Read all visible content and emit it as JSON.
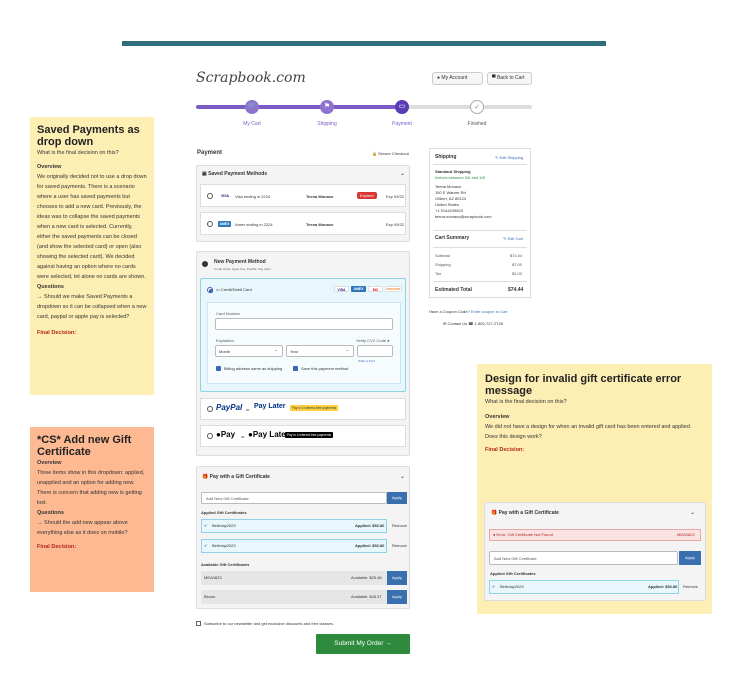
{
  "header": {
    "logo": "Scrapbook.com",
    "my_account": "My Account",
    "back_to_cart": "Back to Cart"
  },
  "steps": [
    {
      "label": "My Cart"
    },
    {
      "label": "Shipping"
    },
    {
      "label": "Payment"
    },
    {
      "label": "Finished"
    }
  ],
  "payment": {
    "title": "Payment",
    "secure": "Secure Checkout",
    "saved_title": "Saved Payment Methods",
    "saved": [
      {
        "brand": "VISA",
        "ending": "Visa ending in 2224",
        "name": "Teena Monaco",
        "badge": "Expired",
        "exp": "Exp 09/22"
      },
      {
        "brand": "AMEX",
        "ending": "Amex ending in 2224",
        "name": "Teena Monaco",
        "badge": "",
        "exp": "Exp 09/22"
      }
    ],
    "new_title": "New Payment Method",
    "new_sub": "Credit cards, Apple Pay, PayPal, Pay Later",
    "card_label": "Credit/Debit Card",
    "card_brands": [
      "VISA",
      "AMEX",
      "MC",
      "DISCOVER"
    ],
    "card_number_label": "Card Number",
    "expiration_label": "Expiration",
    "month_placeholder": "Month",
    "year_placeholder": "Year",
    "cvv_label": "Verify CVV Code",
    "whats_this": "What is this?",
    "billing_same": "Billing address same as shipping",
    "save_method": "Save this payment method",
    "paypal_text": "PayPal",
    "or1": "or",
    "paylater": "Pay Later",
    "paypal_badge": "Pay in 4 interest-free payments",
    "applepay": "Pay",
    "or2": "or",
    "apple_paylater": "Pay Later",
    "apple_badge": "Pay in 4 interest-free payments"
  },
  "gift": {
    "title": "Pay with a Gift Certificate",
    "placeholder": "Add New Gift Certificate",
    "apply": "Apply",
    "applied_title": "Applied Gift Certificates",
    "applied": [
      {
        "code": "Birthday2023",
        "amount": "Applied: $53.80",
        "remove": "Remove"
      },
      {
        "code": "Birthday2023",
        "amount": "Applied: $53.80",
        "remove": "Remove"
      }
    ],
    "available_title": "Available Gift Certificates",
    "available": [
      {
        "code": "MEA0823",
        "amount": "Available: $25.48",
        "apply": "Apply"
      },
      {
        "code": "Bloom",
        "amount": "Available: $45.37",
        "apply": "Apply"
      }
    ]
  },
  "newsletter": "Subscribe to our newsletter and get exclusive discounts and free classes.",
  "submit": "Submit My Order",
  "shipping_box": {
    "title": "Shipping",
    "edit": "Edit Shipping",
    "method": "Standard Shipping",
    "arrives": "Arrives between 3/6 and 3/8",
    "address": [
      "Teena Monaco",
      "150 E Warner Rd",
      "Gilbert, AZ 85123",
      "United States",
      "+1 9144249823",
      "teena.monaco@scrapbook.com"
    ]
  },
  "cart_summary": {
    "title": "Cart Summary",
    "edit": "Edit Cart",
    "rows": [
      {
        "label": "Subtotal",
        "value": "$74.44"
      },
      {
        "label": "Shipping",
        "value": "$7.00"
      },
      {
        "label": "Tax",
        "value": "$2.00"
      }
    ],
    "total_label": "Estimated Total",
    "total_value": "$74.44",
    "coupon_q": "Have a Coupon Code?",
    "coupon_link": "Enter coupon in Cart",
    "contact": "Contact Us",
    "phone": "1-800-727-2726"
  },
  "note_saved": {
    "title": "Saved Payments as drop down",
    "question": "What is the final decision on this?",
    "overview_h": "Overview",
    "overview": "We originally decided not to use a drop down for saved payments. There is a scenario where a user has saved payments but chooses to add a new card. Previously, the ideas was to collapse the saved payments when a new card is selected. Currently, either the saved payments can be closed (and show the selected card) or open (also showing the selected card). We decided against having an option where no cards were selected, let alone no cards are shown.",
    "questions_h": "Questions",
    "questions": "→ Should we make Saved Payments a dropdown so it can be collapsed when a new card, paypal or apple pay is selected?",
    "final": "Final Decision:"
  },
  "note_gift": {
    "title": "*CS* Add new Gift Certificate",
    "overview_h": "Overview",
    "overview": "Three items show in this dropdown: applied, unapplied and an option for adding new. There is concern that adding new is getting lost.",
    "questions_h": "Questions",
    "questions": "→ Should the add new appear above everything else as it does on mobile?",
    "final": "Final Decision:"
  },
  "note_invalid": {
    "title": "Design for invalid gift certificate error message",
    "question": "What is the final decision on this?",
    "overview_h": "Overview",
    "overview": "We did not have a design for when an invalid gift card has been entered and applied. Does this design work?",
    "final": "Final Decision:",
    "widget_title": "Pay with a Gift Certificate",
    "error": "Error: Gift Certificate Not Found",
    "error_code": "MEA0823",
    "placeholder": "Add New Gift Certificate",
    "apply": "Apply",
    "applied_title": "Applied Gift Certificates",
    "applied_code": "Birthday2023",
    "applied_amount": "Applied: $53.80",
    "remove": "Remove"
  },
  "colors": {
    "progress": "#7b5cc7",
    "note_yellow": "#fdeeb3",
    "note_orange": "#fdb992",
    "teal_bar": "#2f6f7e",
    "submit_green": "#2e8b3e"
  }
}
